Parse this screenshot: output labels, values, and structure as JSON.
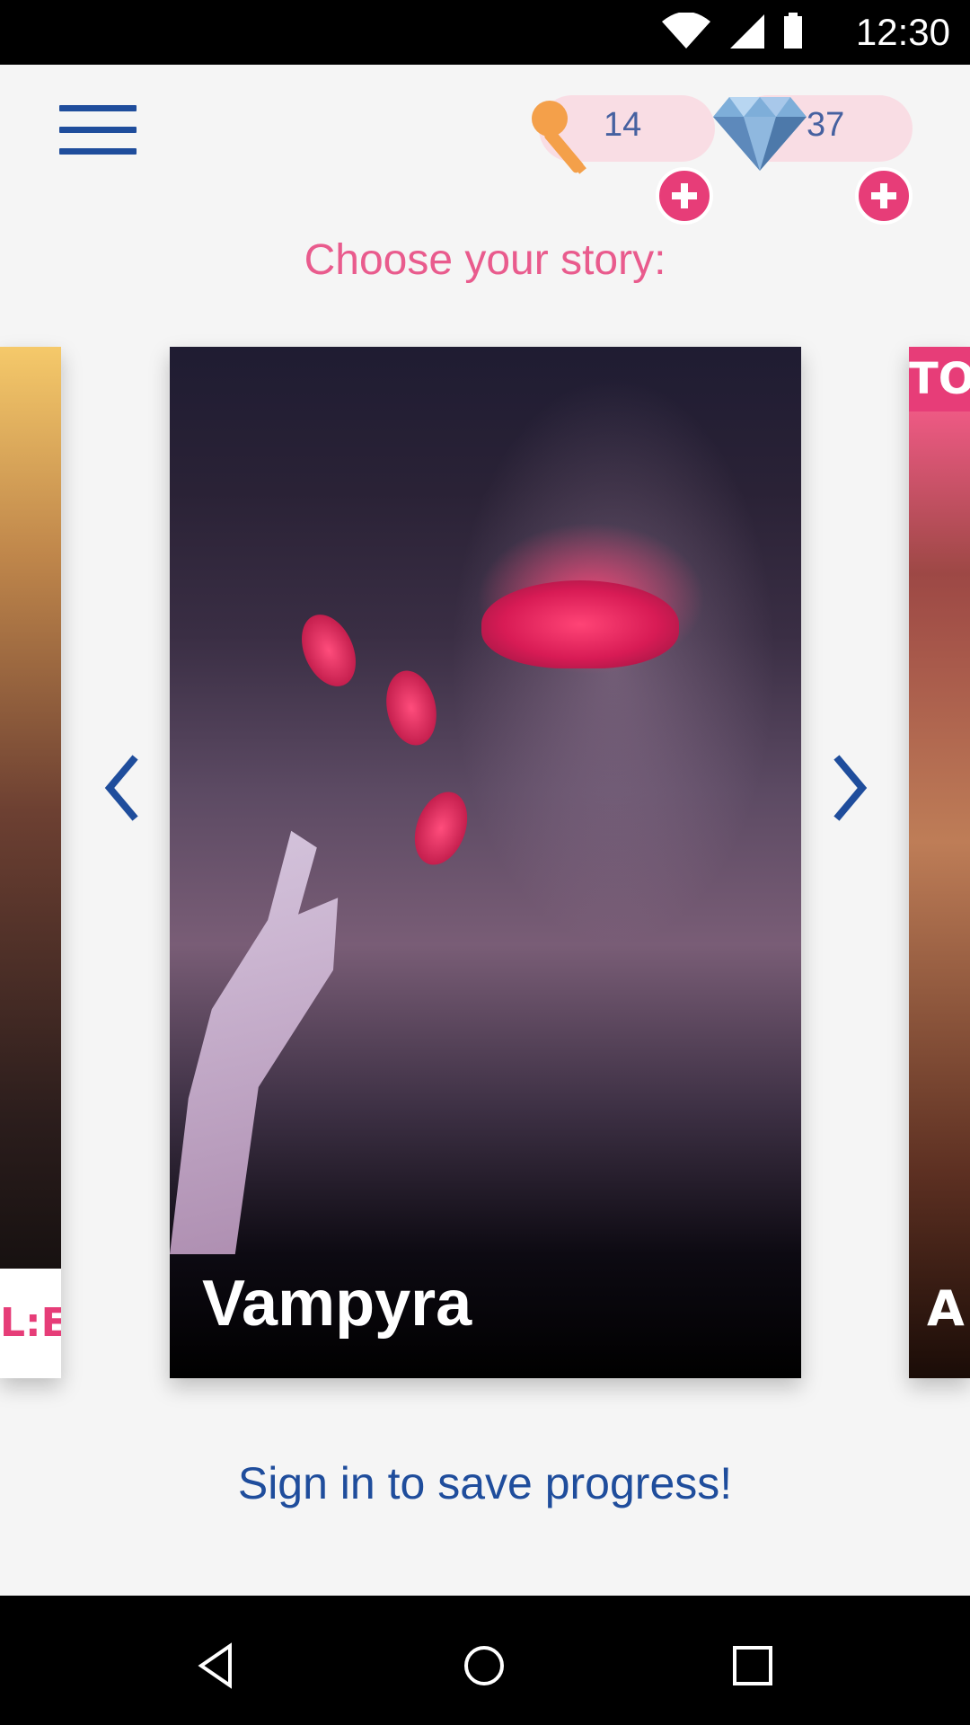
{
  "status_bar": {
    "time": "12:30",
    "icons": [
      "wifi-icon",
      "signal-icon",
      "battery-icon"
    ]
  },
  "header": {
    "menu_icon": "hamburger-menu-icon",
    "keys": {
      "count": "14",
      "icon": "key-icon"
    },
    "gems": {
      "count": "37",
      "icon": "diamond-icon"
    }
  },
  "main": {
    "title": "Choose your story:",
    "cards": [
      {
        "title": ""
      },
      {
        "title": "Vampyra"
      },
      {
        "title": ""
      }
    ],
    "left_partial_text": "L:E",
    "right_partial_text": "TO",
    "right_partial_subtitle": "A",
    "signin_text": "Sign in to save progress!"
  },
  "navigation": {
    "back": "back-icon",
    "home": "home-icon",
    "recent": "recent-apps-icon"
  },
  "colors": {
    "accent_pink": "#e95b8d",
    "accent_blue": "#1f4d9c"
  }
}
